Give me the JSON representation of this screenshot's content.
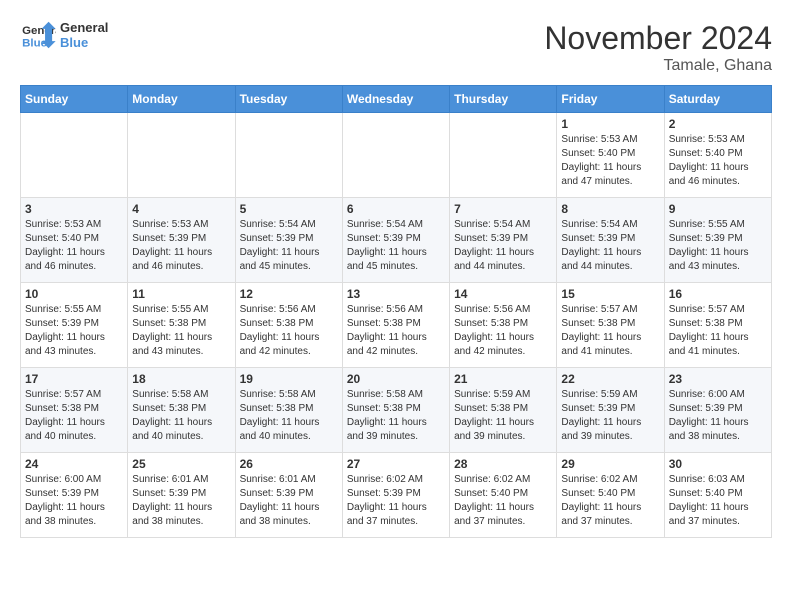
{
  "logo": {
    "line1": "General",
    "line2": "Blue"
  },
  "title": "November 2024",
  "location": "Tamale, Ghana",
  "days_header": [
    "Sunday",
    "Monday",
    "Tuesday",
    "Wednesday",
    "Thursday",
    "Friday",
    "Saturday"
  ],
  "weeks": [
    [
      {
        "day": "",
        "info": ""
      },
      {
        "day": "",
        "info": ""
      },
      {
        "day": "",
        "info": ""
      },
      {
        "day": "",
        "info": ""
      },
      {
        "day": "",
        "info": ""
      },
      {
        "day": "1",
        "info": "Sunrise: 5:53 AM\nSunset: 5:40 PM\nDaylight: 11 hours\nand 47 minutes."
      },
      {
        "day": "2",
        "info": "Sunrise: 5:53 AM\nSunset: 5:40 PM\nDaylight: 11 hours\nand 46 minutes."
      }
    ],
    [
      {
        "day": "3",
        "info": "Sunrise: 5:53 AM\nSunset: 5:40 PM\nDaylight: 11 hours\nand 46 minutes."
      },
      {
        "day": "4",
        "info": "Sunrise: 5:53 AM\nSunset: 5:39 PM\nDaylight: 11 hours\nand 46 minutes."
      },
      {
        "day": "5",
        "info": "Sunrise: 5:54 AM\nSunset: 5:39 PM\nDaylight: 11 hours\nand 45 minutes."
      },
      {
        "day": "6",
        "info": "Sunrise: 5:54 AM\nSunset: 5:39 PM\nDaylight: 11 hours\nand 45 minutes."
      },
      {
        "day": "7",
        "info": "Sunrise: 5:54 AM\nSunset: 5:39 PM\nDaylight: 11 hours\nand 44 minutes."
      },
      {
        "day": "8",
        "info": "Sunrise: 5:54 AM\nSunset: 5:39 PM\nDaylight: 11 hours\nand 44 minutes."
      },
      {
        "day": "9",
        "info": "Sunrise: 5:55 AM\nSunset: 5:39 PM\nDaylight: 11 hours\nand 43 minutes."
      }
    ],
    [
      {
        "day": "10",
        "info": "Sunrise: 5:55 AM\nSunset: 5:39 PM\nDaylight: 11 hours\nand 43 minutes."
      },
      {
        "day": "11",
        "info": "Sunrise: 5:55 AM\nSunset: 5:38 PM\nDaylight: 11 hours\nand 43 minutes."
      },
      {
        "day": "12",
        "info": "Sunrise: 5:56 AM\nSunset: 5:38 PM\nDaylight: 11 hours\nand 42 minutes."
      },
      {
        "day": "13",
        "info": "Sunrise: 5:56 AM\nSunset: 5:38 PM\nDaylight: 11 hours\nand 42 minutes."
      },
      {
        "day": "14",
        "info": "Sunrise: 5:56 AM\nSunset: 5:38 PM\nDaylight: 11 hours\nand 42 minutes."
      },
      {
        "day": "15",
        "info": "Sunrise: 5:57 AM\nSunset: 5:38 PM\nDaylight: 11 hours\nand 41 minutes."
      },
      {
        "day": "16",
        "info": "Sunrise: 5:57 AM\nSunset: 5:38 PM\nDaylight: 11 hours\nand 41 minutes."
      }
    ],
    [
      {
        "day": "17",
        "info": "Sunrise: 5:57 AM\nSunset: 5:38 PM\nDaylight: 11 hours\nand 40 minutes."
      },
      {
        "day": "18",
        "info": "Sunrise: 5:58 AM\nSunset: 5:38 PM\nDaylight: 11 hours\nand 40 minutes."
      },
      {
        "day": "19",
        "info": "Sunrise: 5:58 AM\nSunset: 5:38 PM\nDaylight: 11 hours\nand 40 minutes."
      },
      {
        "day": "20",
        "info": "Sunrise: 5:58 AM\nSunset: 5:38 PM\nDaylight: 11 hours\nand 39 minutes."
      },
      {
        "day": "21",
        "info": "Sunrise: 5:59 AM\nSunset: 5:38 PM\nDaylight: 11 hours\nand 39 minutes."
      },
      {
        "day": "22",
        "info": "Sunrise: 5:59 AM\nSunset: 5:39 PM\nDaylight: 11 hours\nand 39 minutes."
      },
      {
        "day": "23",
        "info": "Sunrise: 6:00 AM\nSunset: 5:39 PM\nDaylight: 11 hours\nand 38 minutes."
      }
    ],
    [
      {
        "day": "24",
        "info": "Sunrise: 6:00 AM\nSunset: 5:39 PM\nDaylight: 11 hours\nand 38 minutes."
      },
      {
        "day": "25",
        "info": "Sunrise: 6:01 AM\nSunset: 5:39 PM\nDaylight: 11 hours\nand 38 minutes."
      },
      {
        "day": "26",
        "info": "Sunrise: 6:01 AM\nSunset: 5:39 PM\nDaylight: 11 hours\nand 38 minutes."
      },
      {
        "day": "27",
        "info": "Sunrise: 6:02 AM\nSunset: 5:39 PM\nDaylight: 11 hours\nand 37 minutes."
      },
      {
        "day": "28",
        "info": "Sunrise: 6:02 AM\nSunset: 5:40 PM\nDaylight: 11 hours\nand 37 minutes."
      },
      {
        "day": "29",
        "info": "Sunrise: 6:02 AM\nSunset: 5:40 PM\nDaylight: 11 hours\nand 37 minutes."
      },
      {
        "day": "30",
        "info": "Sunrise: 6:03 AM\nSunset: 5:40 PM\nDaylight: 11 hours\nand 37 minutes."
      }
    ]
  ]
}
